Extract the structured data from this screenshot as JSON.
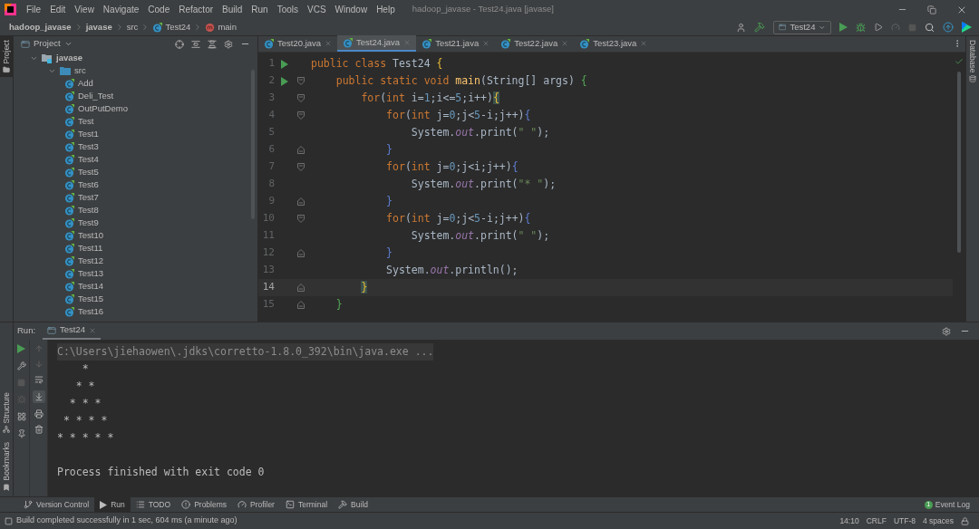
{
  "menu_bar": {
    "items": [
      "File",
      "Edit",
      "View",
      "Navigate",
      "Code",
      "Refactor",
      "Build",
      "Run",
      "Tools",
      "VCS",
      "Window",
      "Help"
    ],
    "title": "hadoop_javase - Test24.java [javase]"
  },
  "breadcrumbs": [
    {
      "label": "hadoop_javase",
      "kind": "project"
    },
    {
      "label": "javase",
      "kind": "module"
    },
    {
      "label": "src",
      "kind": "folder"
    },
    {
      "label": "Test24",
      "kind": "class"
    },
    {
      "label": "main",
      "kind": "method"
    }
  ],
  "toolbar": {
    "run_config": "Test24"
  },
  "side_stripes": {
    "left_top": [
      {
        "label": "Project",
        "selected": true
      }
    ],
    "left_bottom": [
      "Structure",
      "Bookmarks"
    ],
    "right": [
      "Database"
    ]
  },
  "project_panel": {
    "title": "Project",
    "tree": [
      {
        "label": "javase",
        "kind": "module",
        "expanded": true,
        "children": [
          {
            "label": "src",
            "kind": "folder",
            "expanded": true,
            "children": [
              {
                "label": "Add",
                "kind": "class"
              },
              {
                "label": "Deli_Test",
                "kind": "class"
              },
              {
                "label": "OutPutDemo",
                "kind": "class"
              },
              {
                "label": "Test",
                "kind": "class"
              },
              {
                "label": "Test1",
                "kind": "class"
              },
              {
                "label": "Test3",
                "kind": "class"
              },
              {
                "label": "Test4",
                "kind": "class"
              },
              {
                "label": "Test5",
                "kind": "class"
              },
              {
                "label": "Test6",
                "kind": "class"
              },
              {
                "label": "Test7",
                "kind": "class"
              },
              {
                "label": "Test8",
                "kind": "class"
              },
              {
                "label": "Test9",
                "kind": "class"
              },
              {
                "label": "Test10",
                "kind": "class"
              },
              {
                "label": "Test11",
                "kind": "class"
              },
              {
                "label": "Test12",
                "kind": "class"
              },
              {
                "label": "Test13",
                "kind": "class"
              },
              {
                "label": "Test14",
                "kind": "class"
              },
              {
                "label": "Test15",
                "kind": "class"
              },
              {
                "label": "Test16",
                "kind": "class"
              }
            ]
          }
        ]
      }
    ]
  },
  "editor": {
    "tabs": [
      {
        "label": "Test20.java",
        "selected": false
      },
      {
        "label": "Test24.java",
        "selected": true
      },
      {
        "label": "Test21.java",
        "selected": false
      },
      {
        "label": "Test22.java",
        "selected": false
      },
      {
        "label": "Test23.java",
        "selected": false
      }
    ],
    "lines": [
      {
        "number": "1",
        "run_marker": true,
        "fold_start": false,
        "fold_end": false,
        "current": false,
        "tokens": [
          {
            "text": "public class ",
            "kind": "kw"
          },
          {
            "text": "Test24 ",
            "kind": "plain"
          },
          {
            "text": "{",
            "kind": "br_y"
          }
        ]
      },
      {
        "number": "2",
        "run_marker": true,
        "fold_start": true,
        "fold_end": false,
        "current": false,
        "tokens": [
          {
            "text": "    public static void ",
            "kind": "kw"
          },
          {
            "text": "main",
            "kind": "fn"
          },
          {
            "text": "(String[] args) ",
            "kind": "plain"
          },
          {
            "text": "{",
            "kind": "br_g"
          }
        ]
      },
      {
        "number": "3",
        "run_marker": false,
        "fold_start": true,
        "fold_end": false,
        "current": false,
        "tokens": [
          {
            "text": "        for",
            "kind": "kw"
          },
          {
            "text": "(",
            "kind": "plain"
          },
          {
            "text": "int ",
            "kind": "kw"
          },
          {
            "text": "i=",
            "kind": "plain"
          },
          {
            "text": "1",
            "kind": "num"
          },
          {
            "text": ";i<=",
            "kind": "plain"
          },
          {
            "text": "5",
            "kind": "num"
          },
          {
            "text": ";i++)",
            "kind": "plain"
          },
          {
            "text": "{",
            "kind": "br_y",
            "match": true
          }
        ]
      },
      {
        "number": "4",
        "run_marker": false,
        "fold_start": true,
        "fold_end": false,
        "current": false,
        "tokens": [
          {
            "text": "            for",
            "kind": "kw"
          },
          {
            "text": "(",
            "kind": "plain"
          },
          {
            "text": "int ",
            "kind": "kw"
          },
          {
            "text": "j=",
            "kind": "plain"
          },
          {
            "text": "0",
            "kind": "num"
          },
          {
            "text": ";j<",
            "kind": "plain"
          },
          {
            "text": "5",
            "kind": "num"
          },
          {
            "text": "-i;j++)",
            "kind": "plain"
          },
          {
            "text": "{",
            "kind": "br_b"
          }
        ]
      },
      {
        "number": "5",
        "run_marker": false,
        "fold_start": false,
        "fold_end": false,
        "current": false,
        "tokens": [
          {
            "text": "                System.",
            "kind": "plain"
          },
          {
            "text": "out",
            "kind": "field"
          },
          {
            "text": ".print(",
            "kind": "plain"
          },
          {
            "text": "\" \"",
            "kind": "str"
          },
          {
            "text": ");",
            "kind": "plain"
          }
        ]
      },
      {
        "number": "6",
        "run_marker": false,
        "fold_start": false,
        "fold_end": true,
        "current": false,
        "tokens": [
          {
            "text": "            }",
            "kind": "br_b"
          }
        ]
      },
      {
        "number": "7",
        "run_marker": false,
        "fold_start": true,
        "fold_end": false,
        "current": false,
        "tokens": [
          {
            "text": "            for",
            "kind": "kw"
          },
          {
            "text": "(",
            "kind": "plain"
          },
          {
            "text": "int ",
            "kind": "kw"
          },
          {
            "text": "j=",
            "kind": "plain"
          },
          {
            "text": "0",
            "kind": "num"
          },
          {
            "text": ";j<i;j++)",
            "kind": "plain"
          },
          {
            "text": "{",
            "kind": "br_b"
          }
        ]
      },
      {
        "number": "8",
        "run_marker": false,
        "fold_start": false,
        "fold_end": false,
        "current": false,
        "tokens": [
          {
            "text": "                System.",
            "kind": "plain"
          },
          {
            "text": "out",
            "kind": "field"
          },
          {
            "text": ".print(",
            "kind": "plain"
          },
          {
            "text": "\"* \"",
            "kind": "str"
          },
          {
            "text": ");",
            "kind": "plain"
          }
        ]
      },
      {
        "number": "9",
        "run_marker": false,
        "fold_start": false,
        "fold_end": true,
        "current": false,
        "tokens": [
          {
            "text": "            }",
            "kind": "br_b"
          }
        ]
      },
      {
        "number": "10",
        "run_marker": false,
        "fold_start": true,
        "fold_end": false,
        "current": false,
        "tokens": [
          {
            "text": "            for",
            "kind": "kw"
          },
          {
            "text": "(",
            "kind": "plain"
          },
          {
            "text": "int ",
            "kind": "kw"
          },
          {
            "text": "j=",
            "kind": "plain"
          },
          {
            "text": "0",
            "kind": "num"
          },
          {
            "text": ";j<",
            "kind": "plain"
          },
          {
            "text": "5",
            "kind": "num"
          },
          {
            "text": "-i;j++)",
            "kind": "plain"
          },
          {
            "text": "{",
            "kind": "br_b"
          }
        ]
      },
      {
        "number": "11",
        "run_marker": false,
        "fold_start": false,
        "fold_end": false,
        "current": false,
        "tokens": [
          {
            "text": "                System.",
            "kind": "plain"
          },
          {
            "text": "out",
            "kind": "field"
          },
          {
            "text": ".print(",
            "kind": "plain"
          },
          {
            "text": "\" \"",
            "kind": "str"
          },
          {
            "text": ");",
            "kind": "plain"
          }
        ]
      },
      {
        "number": "12",
        "run_marker": false,
        "fold_start": false,
        "fold_end": true,
        "current": false,
        "tokens": [
          {
            "text": "            }",
            "kind": "br_b"
          }
        ]
      },
      {
        "number": "13",
        "run_marker": false,
        "fold_start": false,
        "fold_end": false,
        "current": false,
        "tokens": [
          {
            "text": "            System.",
            "kind": "plain"
          },
          {
            "text": "out",
            "kind": "field"
          },
          {
            "text": ".println();",
            "kind": "plain"
          }
        ]
      },
      {
        "number": "14",
        "run_marker": false,
        "fold_start": false,
        "fold_end": true,
        "current": true,
        "tokens": [
          {
            "text": "        }",
            "kind": "br_y",
            "match": true
          }
        ]
      },
      {
        "number": "15",
        "run_marker": false,
        "fold_start": false,
        "fold_end": true,
        "current": false,
        "tokens": [
          {
            "text": "    }",
            "kind": "br_g"
          }
        ]
      }
    ]
  },
  "run_panel": {
    "label": "Run:",
    "tabs": [
      {
        "label": "Test24",
        "selected": true
      }
    ],
    "console": [
      {
        "text": "C:\\Users\\jiehaowen\\.jdks\\corretto-1.8.0_392\\bin\\java.exe ...",
        "kind": "command"
      },
      {
        "text": "    *\n   * *\n  * * *\n * * * *\n* * * * *",
        "kind": "output"
      },
      {
        "text": "Process finished with exit code 0",
        "kind": "exit"
      }
    ]
  },
  "tool_tabs": [
    {
      "label": "Version Control",
      "kind": "vcs",
      "selected": false
    },
    {
      "label": "Run",
      "kind": "run",
      "selected": true
    },
    {
      "label": "TODO",
      "kind": "todo",
      "selected": false
    },
    {
      "label": "Problems",
      "kind": "problems",
      "selected": false
    },
    {
      "label": "Profiler",
      "kind": "profiler",
      "selected": false
    },
    {
      "label": "Terminal",
      "kind": "terminal",
      "selected": false
    },
    {
      "label": "Build",
      "kind": "build",
      "selected": false
    }
  ],
  "event_log": {
    "label": "Event Log",
    "count": "1"
  },
  "status_bar": {
    "message": "Build completed successfully in 1 sec, 604 ms (a minute ago)",
    "items": [
      "14:10",
      "CRLF",
      "UTF-8",
      "4 spaces"
    ]
  }
}
